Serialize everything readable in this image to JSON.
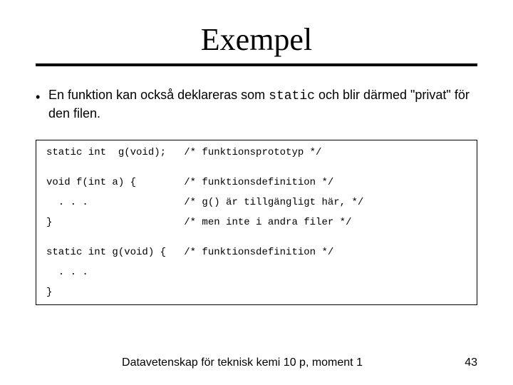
{
  "title": "Exempel",
  "bullet": {
    "pre": "En funktion kan också deklareras som ",
    "code": "static",
    "post": " och blir därmed \"privat\" för den filen."
  },
  "code": "static int  g(void);   /* funktionsprototyp */\n\n\nvoid f(int a) {        /* funktionsdefinition */\n\n  . . .                /* g() är tillgängligt här, */\n\n}                      /* men inte i andra filer */\n\n\nstatic int g(void) {   /* funktionsdefinition */\n\n  . . .\n\n}",
  "footer": {
    "course": "Datavetenskap för teknisk kemi 10 p, moment 1",
    "page": "43"
  }
}
